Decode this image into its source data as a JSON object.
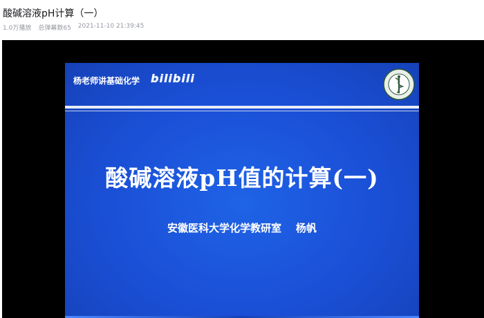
{
  "video": {
    "title": "酸碱溶液pH计算（一）",
    "views": "1.0万播放",
    "danmaku": "总弹幕数65",
    "datetime": "2021-11-10 21:39:45"
  },
  "slide": {
    "header_label": "杨老师讲基础化学",
    "brand_logo": "bilibili",
    "emblem_icon": "university-emblem-icon",
    "title": "酸碱溶液pH值的计算(一)",
    "subtitle": "安徽医科大学化学教研室    杨帆",
    "background_color": "#1a4fd6"
  },
  "colors": {
    "title_text": "#18191c",
    "meta_text": "#9499a0",
    "player_bg": "#000000"
  }
}
